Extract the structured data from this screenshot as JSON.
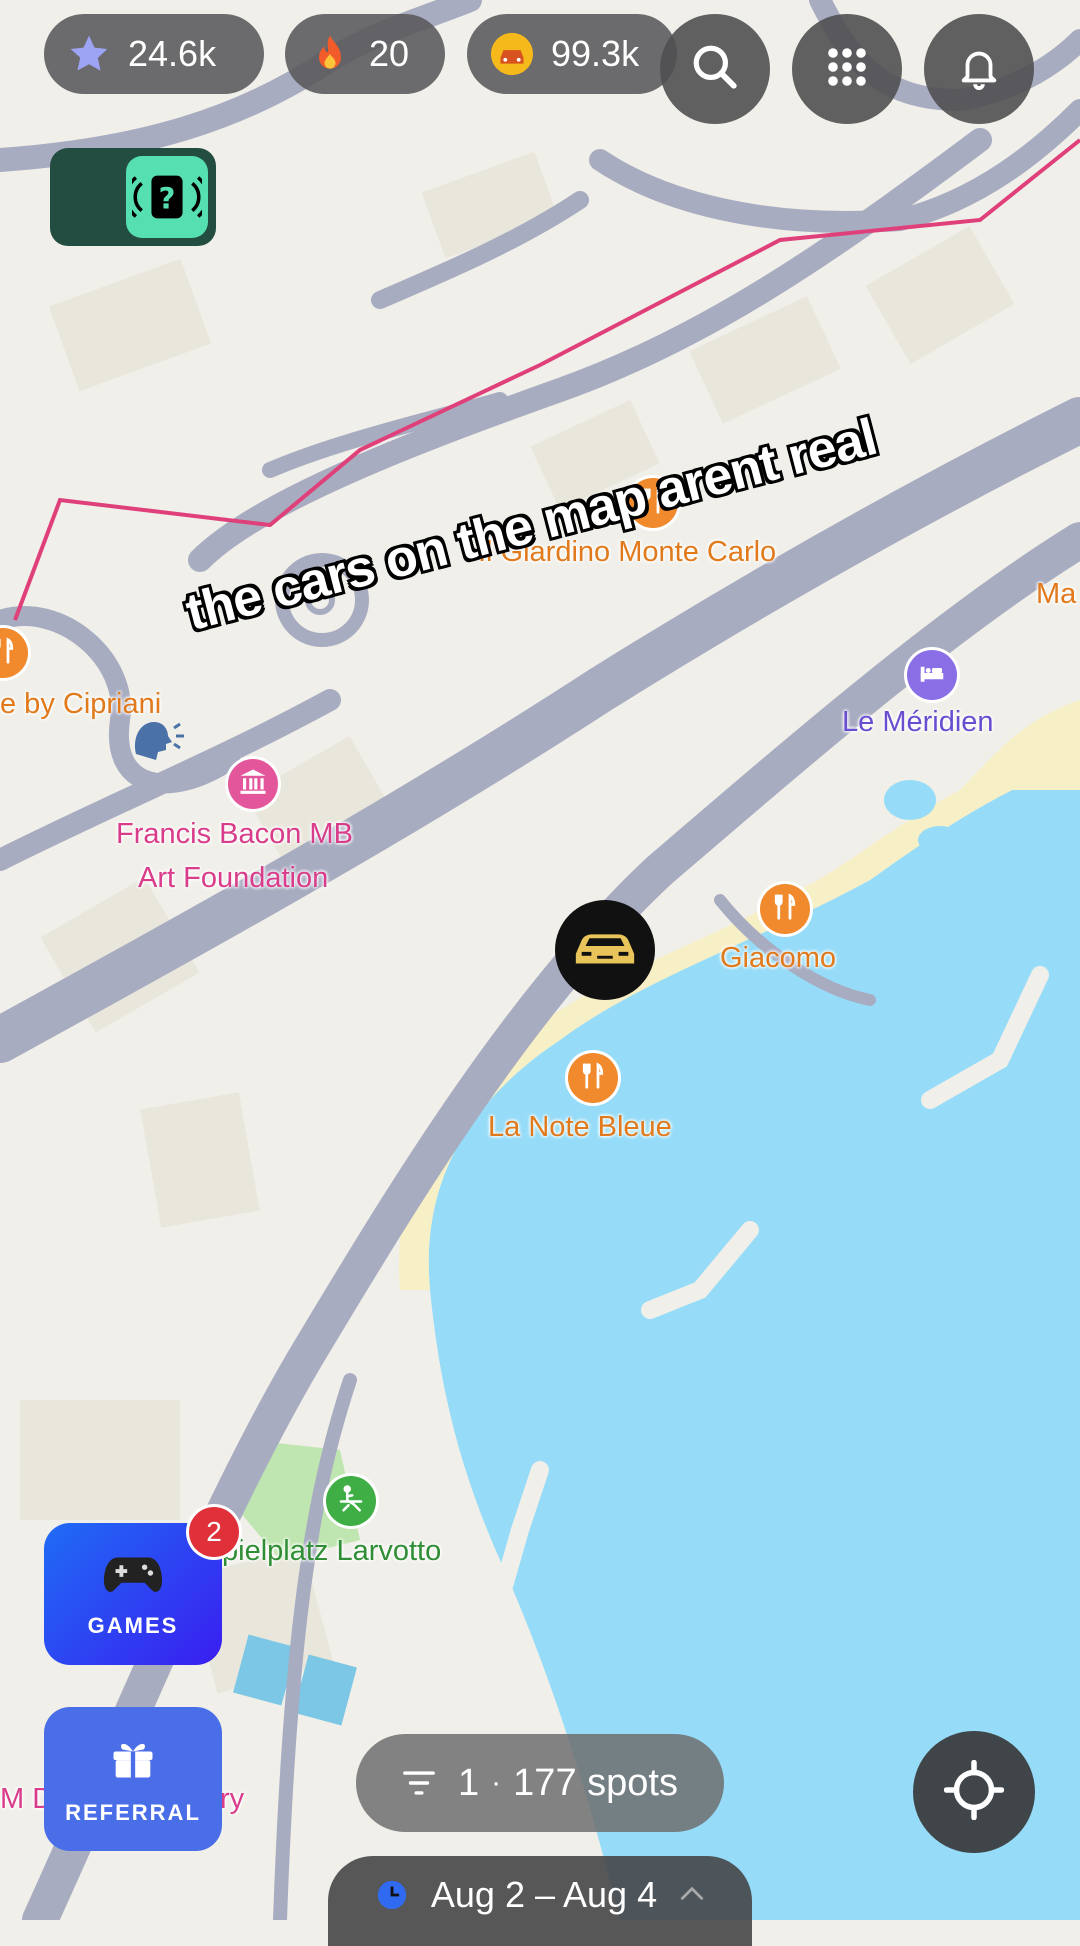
{
  "stats": {
    "stars": "24.6k",
    "streak": "20",
    "coins": "99.3k"
  },
  "icons": {
    "stars": "star-icon",
    "streak": "fire-icon",
    "coins": "coin-car-icon",
    "search": "search-icon",
    "menu": "grid-menu-icon",
    "notifications": "bell-icon",
    "mystery": "mystery-box-icon",
    "games": "gamepad-icon",
    "referral": "gift-icon",
    "filter": "filter-icon",
    "clock": "clock-icon",
    "chevron": "chevron-up-icon",
    "locate": "crosshair-icon"
  },
  "map": {
    "labels": {
      "giardino": "Il Giardino Monte Carlo",
      "ma": "Ma",
      "cipriani": "e by Cipriani",
      "meridien": "Le Méridien",
      "bacon_line1": "Francis Bacon MB",
      "bacon_line2": "Art Foundation",
      "giacomo": "Giacomo",
      "note_bleue": "La Note Bleue",
      "spielplatz": "pielplatz Larvotto",
      "md": "M D",
      "ry": "ry"
    }
  },
  "caption": "the cars on the map arent real",
  "games": {
    "label": "GAMES",
    "badge": "2"
  },
  "referral": {
    "label": "REFERRAL"
  },
  "spots": {
    "filter_count": "1",
    "separator": "·",
    "count_text": "177 spots"
  },
  "dates": {
    "range": "Aug 2 – Aug 4"
  },
  "colors": {
    "water": "#96dcf8",
    "beach": "#f7efc5",
    "road": "#a8acc1",
    "route": "#e0407a",
    "restaurant_poi": "#f08a2c",
    "hotel_poi": "#8a6ee6",
    "museum_poi": "#e4569b",
    "park_poi": "#3fae44",
    "games_bg": "#2a3cf0",
    "referral_bg": "#4a6ee8",
    "badge": "#e0303a"
  }
}
